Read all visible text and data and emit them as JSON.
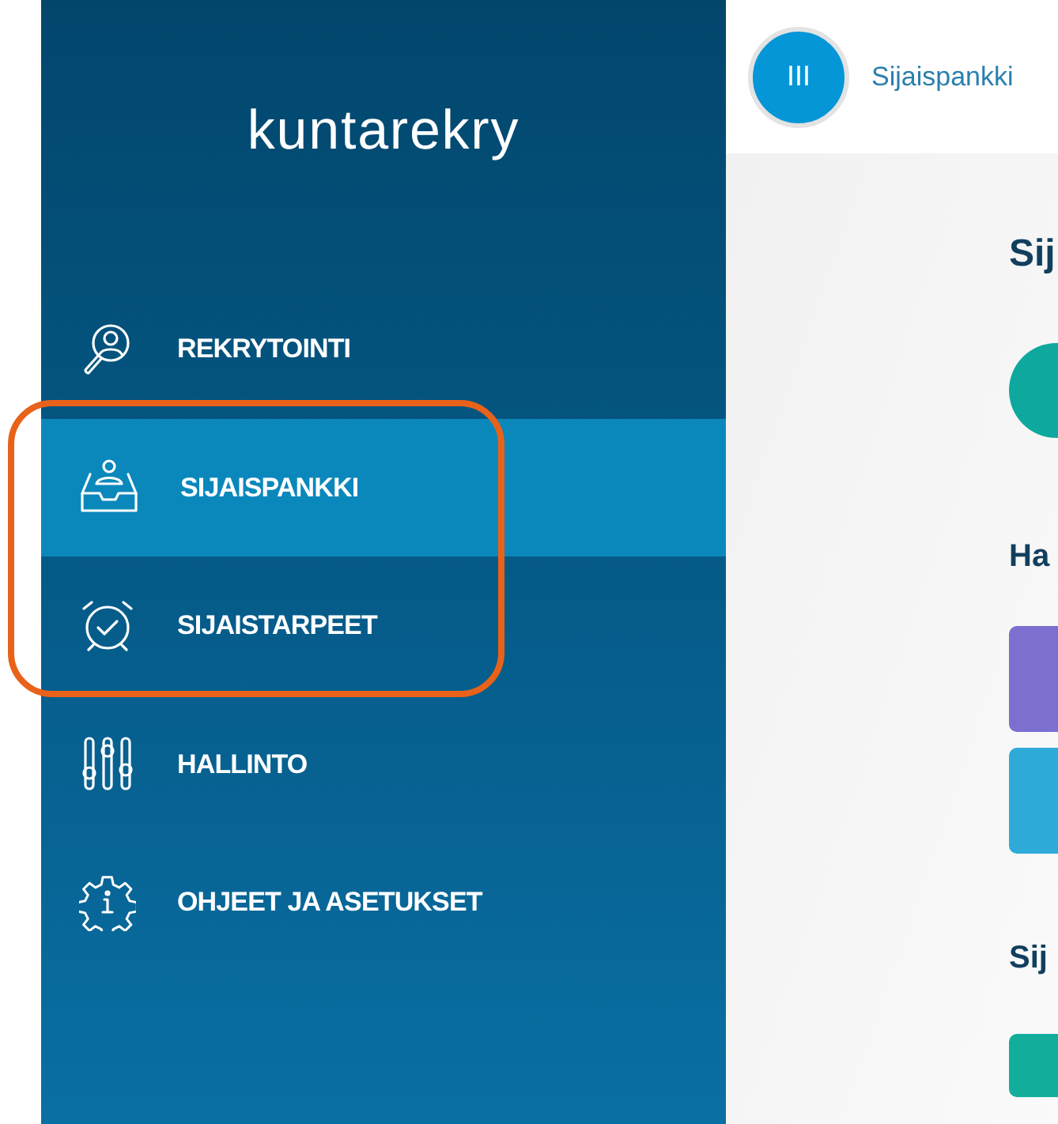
{
  "sidebar": {
    "logo": "kuntarekry",
    "items": [
      {
        "label": "REKRYTOINTI",
        "kind": "search-person",
        "selected": false
      },
      {
        "label": "SIJAISPANKKI",
        "kind": "inbox-person",
        "selected": true
      },
      {
        "label": "SIJAISTARPEET",
        "kind": "alarm-check",
        "selected": false
      },
      {
        "label": "HALLINTO",
        "kind": "sliders",
        "selected": false
      },
      {
        "label": "OHJEET JA ASETUKSET",
        "kind": "gear-info",
        "selected": false
      }
    ]
  },
  "header": {
    "menu_button": "III",
    "breadcrumb": "Sijaispankki"
  },
  "main": {
    "title": "Sij",
    "section_1": "Ha",
    "tiles": [
      {
        "color": "#7b6fd0"
      },
      {
        "color": "#2eaad9"
      }
    ],
    "section_2": "Sij"
  }
}
